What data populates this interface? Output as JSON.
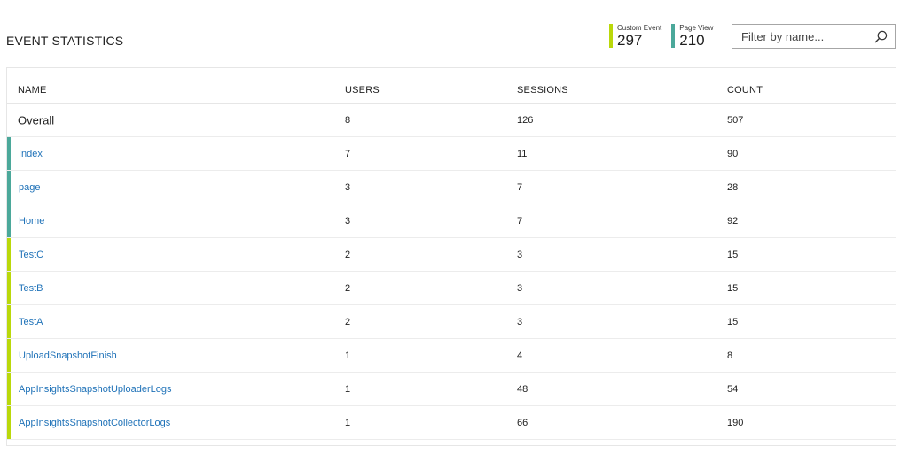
{
  "page": {
    "title": "EVENT STATISTICS"
  },
  "stats": [
    {
      "label": "Custom Event",
      "value": "297",
      "color": "#bad80a"
    },
    {
      "label": "Page View",
      "value": "210",
      "color": "#4ba89a"
    }
  ],
  "search": {
    "placeholder": "Filter by name...",
    "value": "",
    "icon": "search-icon"
  },
  "table": {
    "headers": {
      "name": "NAME",
      "users": "USERS",
      "sessions": "SESSIONS",
      "count": "COUNT"
    },
    "overall": {
      "name": "Overall",
      "users": "8",
      "sessions": "126",
      "count": "507"
    },
    "rows": [
      {
        "name": "Index",
        "users": "7",
        "sessions": "11",
        "count": "90",
        "type": "page-view"
      },
      {
        "name": "page",
        "users": "3",
        "sessions": "7",
        "count": "28",
        "type": "page-view"
      },
      {
        "name": "Home",
        "users": "3",
        "sessions": "7",
        "count": "92",
        "type": "page-view"
      },
      {
        "name": "TestC",
        "users": "2",
        "sessions": "3",
        "count": "15",
        "type": "custom-event"
      },
      {
        "name": "TestB",
        "users": "2",
        "sessions": "3",
        "count": "15",
        "type": "custom-event"
      },
      {
        "name": "TestA",
        "users": "2",
        "sessions": "3",
        "count": "15",
        "type": "custom-event"
      },
      {
        "name": "UploadSnapshotFinish",
        "users": "1",
        "sessions": "4",
        "count": "8",
        "type": "custom-event"
      },
      {
        "name": "AppInsightsSnapshotUploaderLogs",
        "users": "1",
        "sessions": "48",
        "count": "54",
        "type": "custom-event"
      },
      {
        "name": "AppInsightsSnapshotCollectorLogs",
        "users": "1",
        "sessions": "66",
        "count": "190",
        "type": "custom-event"
      }
    ]
  },
  "colors": {
    "custom_event": "#bad80a",
    "page_view": "#4ba89a",
    "link": "#1f72b8"
  }
}
